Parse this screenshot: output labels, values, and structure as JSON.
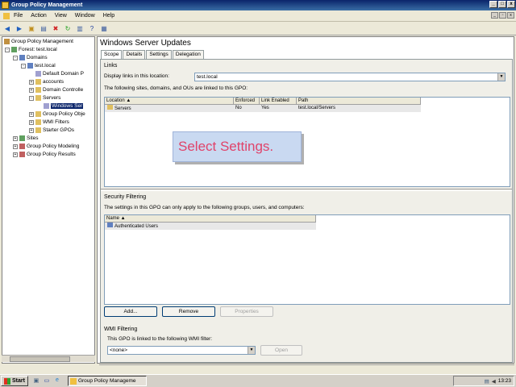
{
  "window": {
    "title": "Group Policy Management"
  },
  "menu": [
    "File",
    "Action",
    "View",
    "Window",
    "Help"
  ],
  "tree": {
    "root": "Group Policy Management",
    "forest": "Forest: test.local",
    "domains": "Domains",
    "domain": "test.local",
    "default_policy": "Default Domain P",
    "accounts": "accounts",
    "dcs": "Domain Controlle",
    "servers": "Servers",
    "selected": "Windows Ser",
    "gpo": "Group Policy Obje",
    "wmi": "WMI Filters",
    "starter": "Starter GPOs",
    "sites": "Sites",
    "modeling": "Group Policy Modeling",
    "results": "Group Policy Results"
  },
  "details": {
    "title": "Windows Server Updates",
    "tabs": [
      "Scope",
      "Details",
      "Settings",
      "Delegation"
    ],
    "links": {
      "header": "Links",
      "display_label": "Display links in this location:",
      "display_value": "test.local",
      "desc": "The following sites, domains, and OUs are linked to this GPO:",
      "columns": [
        "Location",
        "Enforced",
        "Link Enabled",
        "Path"
      ],
      "rows": [
        {
          "location": "Servers",
          "enforced": "No",
          "enabled": "Yes",
          "path": "test.local/Servers"
        }
      ]
    },
    "security": {
      "header": "Security Filtering",
      "desc": "The settings in this GPO can only apply to the following groups, users, and computers:",
      "column": "Name",
      "rows": [
        "Authenticated Users"
      ],
      "buttons": {
        "add": "Add...",
        "remove": "Remove",
        "properties": "Properties"
      }
    },
    "wmi": {
      "header": "WMI Filtering",
      "desc": "This GPO is linked to the following WMI filter:",
      "value": "<none>",
      "open": "Open"
    }
  },
  "overlay": {
    "text": "Select Settings."
  },
  "taskbar": {
    "start": "Start",
    "task": "Group Policy Manageme",
    "clock": "13:23"
  }
}
